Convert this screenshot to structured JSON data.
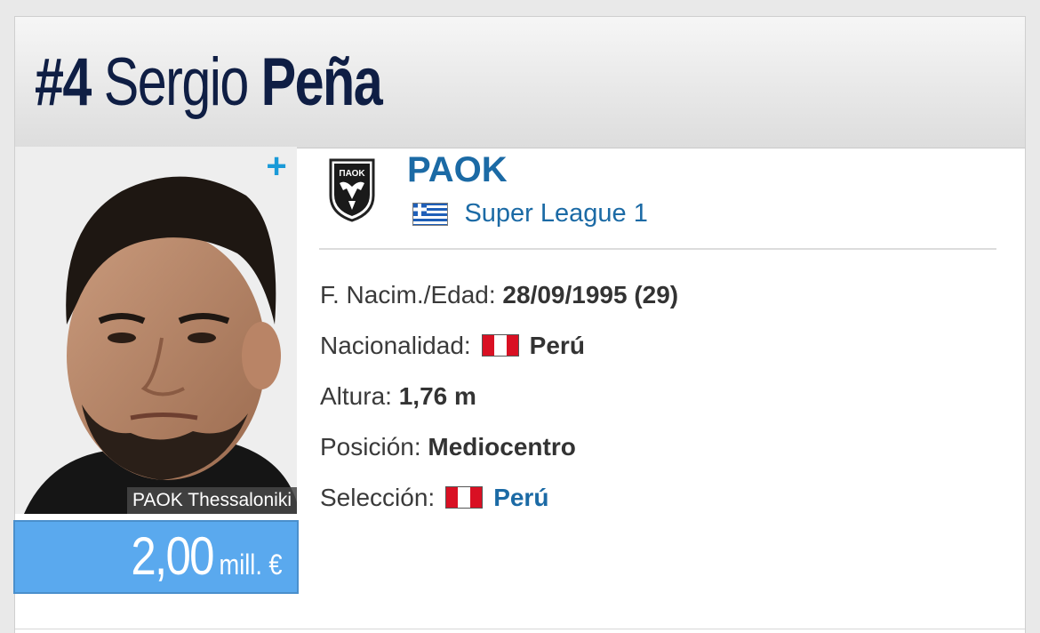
{
  "player": {
    "number": "#4",
    "first_name": "Sergio",
    "last_name": "Peña",
    "photo_caption": "PAOK Thessaloniki",
    "market_value": "2,00",
    "market_value_unit": "mill. €",
    "plus_icon": "plus-icon"
  },
  "club": {
    "name": "PAOK",
    "league": "Super League 1",
    "league_flag": "greece-flag",
    "crest_text": "ΠΑΟΚ"
  },
  "info": {
    "birth_label": "F. Nacim./Edad:",
    "birth_value": "28/09/1995 (29)",
    "nationality_label": "Nacionalidad:",
    "nationality_value": "Perú",
    "height_label": "Altura:",
    "height_value": "1,76 m",
    "position_label": "Posición:",
    "position_value": "Mediocentro",
    "national_team_label": "Selección:",
    "national_team_value": "Perú"
  },
  "colors": {
    "accent": "#1b6aa5",
    "value_box": "#5aa9ee",
    "title": "#0f1e44",
    "plus": "#1a9ad8"
  }
}
